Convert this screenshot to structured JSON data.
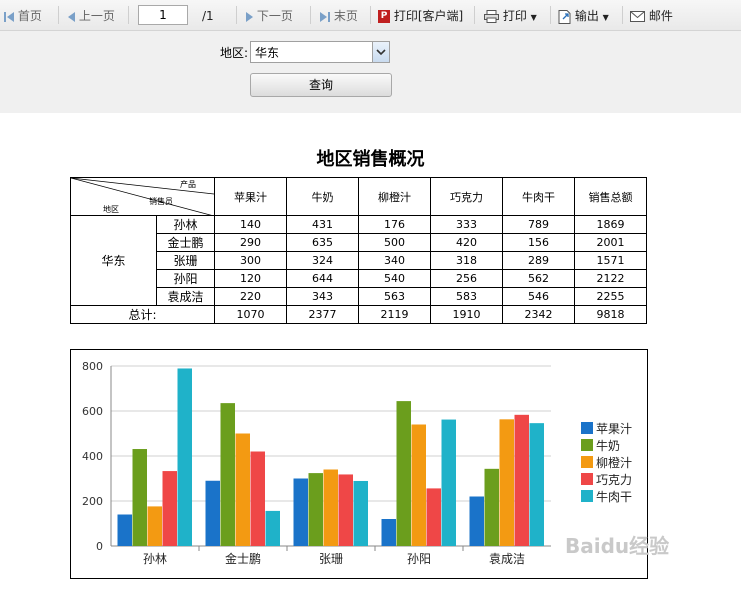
{
  "toolbar": {
    "first": "首页",
    "prev": "上一页",
    "page": "1",
    "total": "/1",
    "next": "下一页",
    "last": "末页",
    "print_client": "打印[客户端]",
    "print": "打印",
    "export": "输出",
    "mail": "邮件"
  },
  "filter": {
    "label": "地区:",
    "region": "华东",
    "query": "查询"
  },
  "report": {
    "title": "地区销售概况",
    "corner": {
      "product": "产品",
      "sales": "销售员",
      "region": "地区"
    },
    "columns": [
      "苹果汁",
      "牛奶",
      "柳橙汁",
      "巧克力",
      "牛肉干",
      "销售总额"
    ],
    "region": "华东",
    "rows": [
      {
        "name": "孙林",
        "values": [
          "140",
          "431",
          "176",
          "333",
          "789",
          "1869"
        ]
      },
      {
        "name": "金士鹏",
        "values": [
          "290",
          "635",
          "500",
          "420",
          "156",
          "2001"
        ]
      },
      {
        "name": "张珊",
        "values": [
          "300",
          "324",
          "340",
          "318",
          "289",
          "1571"
        ]
      },
      {
        "name": "孙阳",
        "values": [
          "120",
          "644",
          "540",
          "256",
          "562",
          "2122"
        ]
      },
      {
        "name": "袁成洁",
        "values": [
          "220",
          "343",
          "563",
          "583",
          "546",
          "2255"
        ]
      }
    ],
    "total_label": "总计:",
    "totals": [
      "1070",
      "2377",
      "2119",
      "1910",
      "2342",
      "9818"
    ]
  },
  "chart_data": {
    "type": "bar",
    "categories": [
      "孙林",
      "金士鹏",
      "张珊",
      "孙阳",
      "袁成洁"
    ],
    "series": [
      {
        "name": "苹果汁",
        "color": "#1a73c9",
        "values": [
          140,
          290,
          300,
          120,
          220
        ]
      },
      {
        "name": "牛奶",
        "color": "#6b9e1d",
        "values": [
          431,
          635,
          324,
          644,
          343
        ]
      },
      {
        "name": "柳橙汁",
        "color": "#f39a12",
        "values": [
          176,
          500,
          340,
          540,
          563
        ]
      },
      {
        "name": "巧克力",
        "color": "#ef4747",
        "values": [
          333,
          420,
          318,
          256,
          583
        ]
      },
      {
        "name": "牛肉干",
        "color": "#1fb2c9",
        "values": [
          789,
          156,
          289,
          562,
          546
        ]
      }
    ],
    "yticks": [
      "0",
      "200",
      "400",
      "600",
      "800"
    ],
    "ylim": [
      0,
      800
    ],
    "grid": true,
    "legend": "right"
  },
  "watermark": "Baidu经验"
}
